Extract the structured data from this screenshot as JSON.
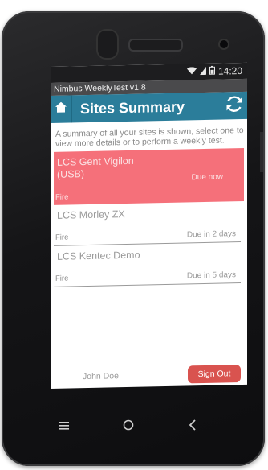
{
  "status_bar": {
    "time": "14:20"
  },
  "app": {
    "title": "Nimbus WeeklyTest v1.8"
  },
  "header": {
    "title": "Sites Summary"
  },
  "description": "A summary of all your sites is shown, select one to view more details or to perform a weekly test.",
  "sites": [
    {
      "name": "LCS Gent Vigilon (USB)",
      "type": "Fire",
      "due": "Due now",
      "status": "alert",
      "color": "#f5707a"
    },
    {
      "name": "LCS Morley ZX",
      "type": "Fire",
      "due": "Due in 2 days",
      "status": "normal"
    },
    {
      "name": "LCS Kentec Demo",
      "type": "Fire",
      "due": "Due in 5 days",
      "status": "normal"
    }
  ],
  "footer": {
    "user": "John Doe",
    "signout_label": "Sign Out"
  },
  "colors": {
    "header": "#2b7d9a",
    "signout": "#d9534f"
  },
  "icons": [
    "wifi-icon",
    "sim-icon",
    "battery-icon",
    "home-icon",
    "refresh-icon",
    "menu-icon",
    "home-circle-icon",
    "back-icon"
  ]
}
